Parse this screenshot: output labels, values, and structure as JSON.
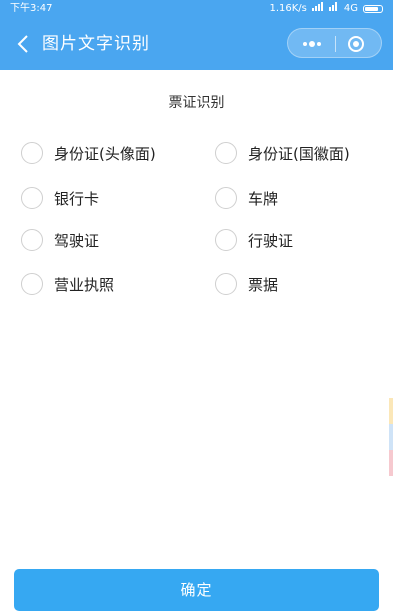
{
  "status_bar": {
    "time": "下午3:47",
    "net_speed": "1.16K/s",
    "signal_text": "4G"
  },
  "nav": {
    "title": "图片文字识别"
  },
  "section_title": "票证识别",
  "options": [
    {
      "label": "身份证(头像面)",
      "checked": true
    },
    {
      "label": "身份证(国徽面)",
      "checked": false
    },
    {
      "label": "银行卡",
      "checked": false
    },
    {
      "label": "车牌",
      "checked": false
    },
    {
      "label": "驾驶证",
      "checked": false
    },
    {
      "label": "行驶证",
      "checked": false
    },
    {
      "label": "营业执照",
      "checked": false
    },
    {
      "label": "票据",
      "checked": false
    }
  ],
  "confirm_label": "确定",
  "colors": {
    "header": "#4aa6f0",
    "accent": "#2e9ff0",
    "button": "#36a8f2"
  }
}
